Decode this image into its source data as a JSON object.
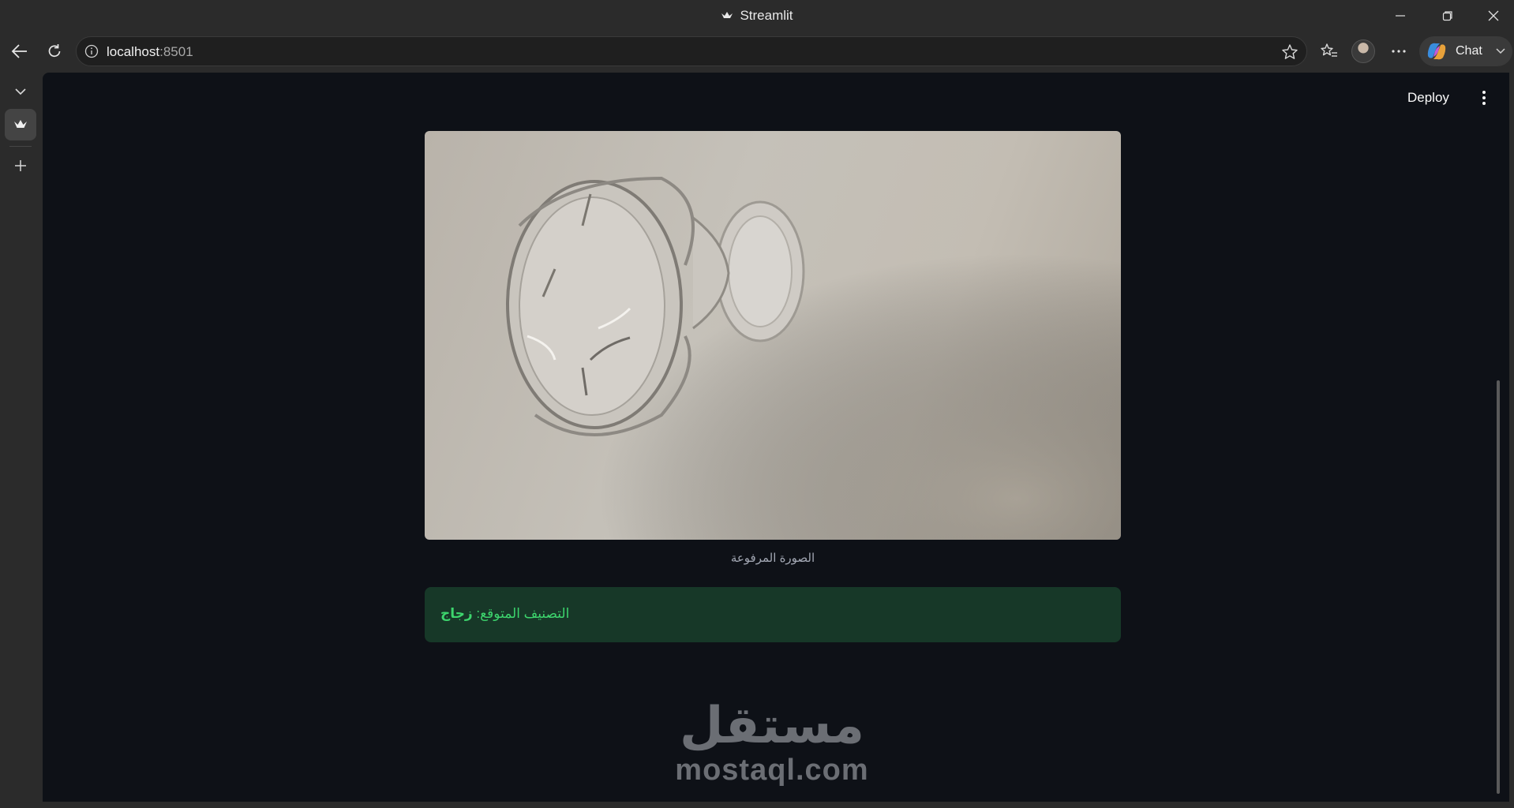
{
  "window": {
    "title": "Streamlit"
  },
  "browser": {
    "url_host": "localhost",
    "url_port": ":8501",
    "chat_label": "Chat"
  },
  "app": {
    "deploy_label": "Deploy",
    "image_caption": "الصورة المرفوعة",
    "prediction_prefix": "التصنيف المتوقع: ",
    "prediction_value": "زجاج"
  },
  "watermark": {
    "arabic": "مستقل",
    "latin": "mostaql.com"
  },
  "colors": {
    "app_background": "#0e1117",
    "success_background": "#173828",
    "success_text": "#3dd56d"
  }
}
